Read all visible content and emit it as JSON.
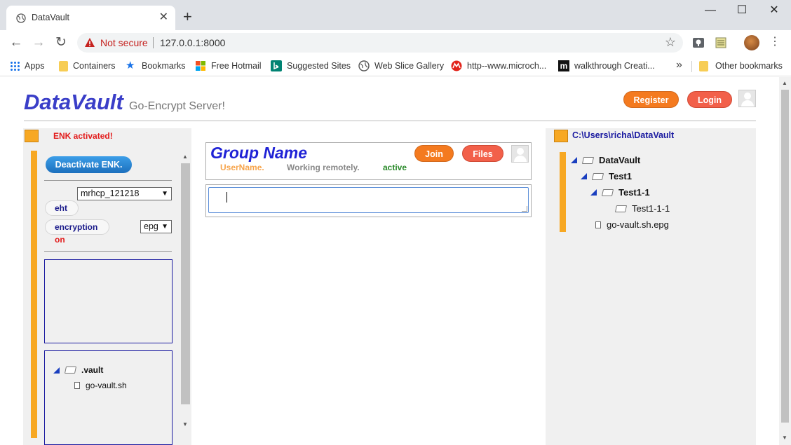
{
  "browser": {
    "tab_title": "DataVault",
    "new_tab_symbol": "+",
    "window_controls": {
      "minimize": "—",
      "maximize": "☐",
      "close": "✕"
    },
    "nav": {
      "back": "←",
      "forward": "→",
      "reload": "↻"
    },
    "omnibox": {
      "security_label": "Not secure",
      "url": "127.0.0.1:8000"
    },
    "bookmarks": [
      {
        "label": "Apps",
        "icon": "apps-icon"
      },
      {
        "label": "Containers",
        "icon": "folder-icon"
      },
      {
        "label": "Bookmarks",
        "icon": "star-icon"
      },
      {
        "label": "Free Hotmail",
        "icon": "windows-icon"
      },
      {
        "label": "Suggested Sites",
        "icon": "bing-icon"
      },
      {
        "label": "Web Slice Gallery",
        "icon": "globe-icon"
      },
      {
        "label": "http--www.microch...",
        "icon": "microchip-icon"
      },
      {
        "label": "walkthrough Creati...",
        "icon": "m-icon"
      }
    ],
    "bookmarks_overflow": "»",
    "other_bookmarks": "Other bookmarks"
  },
  "header": {
    "brand": "DataVault",
    "subtitle": "Go-Encrypt Server!",
    "register_label": "Register",
    "login_label": "Login"
  },
  "left_panel": {
    "enk_status": "ENK activated!",
    "deactivate_label": "Deactivate ENK.",
    "key_select": "mrhcp_121218",
    "eht_label": "eht",
    "encryption_label": "encryption",
    "format_select": "epg",
    "encryption_state": "on",
    "tree": {
      "folder": ".vault",
      "file": "go-vault.sh"
    }
  },
  "group": {
    "name": "Group Name",
    "username": "UserName.",
    "status_text": "Working remotely.",
    "presence": "active",
    "join_label": "Join",
    "files_label": "Files"
  },
  "message": {
    "value": ""
  },
  "right_panel": {
    "path": "C:\\Users\\richa\\DataVault",
    "tree": [
      {
        "label": "DataVault",
        "type": "folder",
        "depth": 0
      },
      {
        "label": "Test1",
        "type": "folder",
        "depth": 1
      },
      {
        "label": "Test1-1",
        "type": "folder",
        "depth": 2
      },
      {
        "label": "Test1-1-1",
        "type": "folder",
        "depth": 3
      },
      {
        "label": "go-vault.sh.epg",
        "type": "file",
        "depth": 1
      }
    ]
  },
  "colors": {
    "brand": "#3a3ec8",
    "accent_orange": "#f47a1f",
    "accent_red": "#f2604a",
    "panel_bg": "#f0f0f0",
    "status_red": "#e21b1b",
    "tree_blue": "#1a3fbf"
  }
}
